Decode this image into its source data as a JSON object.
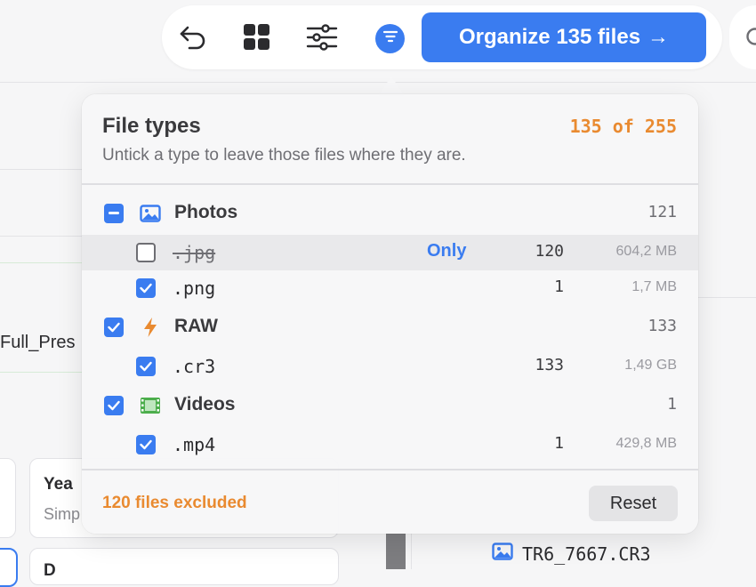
{
  "toolbar": {
    "undo_icon": "undo-icon",
    "grid_icon": "grid-icon",
    "settings_icon": "sliders-icon",
    "filter_icon": "filter-icon",
    "organize_label": "Organize 135 files",
    "organize_arrow": "→",
    "search_icon": "search-icon",
    "accent": "#3a7cf0"
  },
  "background": {
    "partial_text": "Full_Pres",
    "card_title": "Yea",
    "card_subtitle": "Simp",
    "card2_title": "D",
    "file_name": "TR6_7667.CR3"
  },
  "popover": {
    "title": "File types",
    "count": "135 of 255",
    "subtitle": "Untick a type to leave those files where they are.",
    "groups": [
      {
        "label": "Photos",
        "count": "121",
        "state": "mixed",
        "icon": "image-icon",
        "items": [
          {
            "ext": ".jpg",
            "count": "120",
            "size": "604,2 MB",
            "checked": false,
            "only_label": "Only"
          },
          {
            "ext": ".png",
            "count": "1",
            "size": "1,7 MB",
            "checked": true
          }
        ]
      },
      {
        "label": "RAW",
        "count": "133",
        "state": "checked",
        "icon": "bolt-icon",
        "items": [
          {
            "ext": ".cr3",
            "count": "133",
            "size": "1,49 GB",
            "checked": true
          }
        ]
      },
      {
        "label": "Videos",
        "count": "1",
        "state": "checked",
        "icon": "film-icon",
        "items": [
          {
            "ext": ".mp4",
            "count": "1",
            "size": "429,8 MB",
            "checked": true
          }
        ]
      }
    ],
    "excluded_label": "120 files excluded",
    "reset_label": "Reset",
    "warning_color": "#e98a30"
  }
}
